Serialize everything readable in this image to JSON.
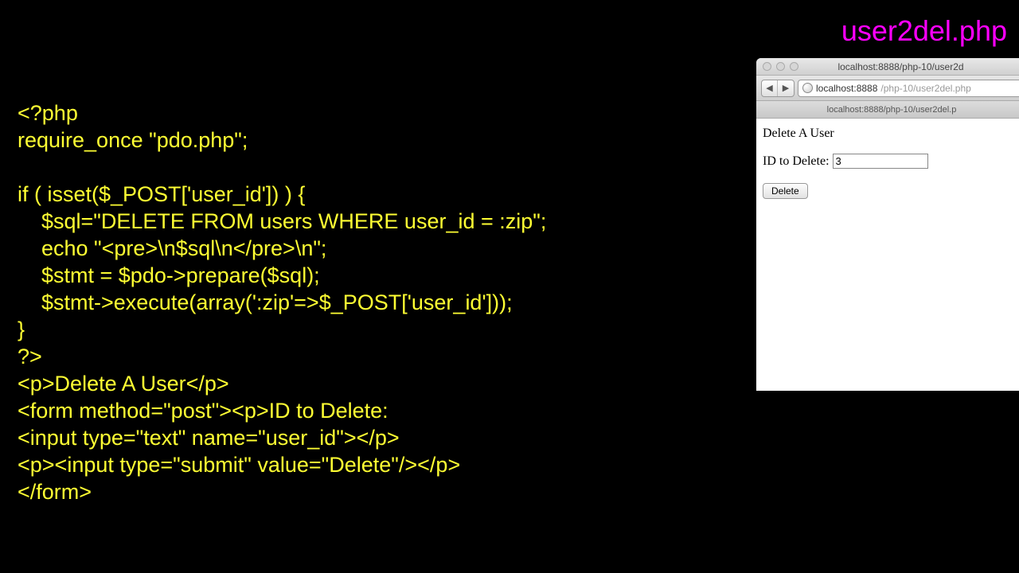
{
  "filename": "user2del.php",
  "code_lines": [
    "<?php",
    "require_once \"pdo.php\";",
    "",
    "if ( isset($_POST['user_id']) ) {",
    "    $sql=\"DELETE FROM users WHERE user_id = :zip\";",
    "    echo \"<pre>\\n$sql\\n</pre>\\n\";",
    "    $stmt = $pdo->prepare($sql);",
    "    $stmt->execute(array(':zip'=>$_POST['user_id']));",
    "}",
    "?>",
    "<p>Delete A User</p>",
    "<form method=\"post\"><p>ID to Delete:",
    "<input type=\"text\" name=\"user_id\"></p>",
    "<p><input type=\"submit\" value=\"Delete\"/></p>",
    "</form>"
  ],
  "browser": {
    "title": "localhost:8888/php-10/user2d",
    "address_host": "localhost:8888",
    "address_path": "/php-10/user2del.php",
    "tab": "localhost:8888/php-10/user2del.p",
    "nav_back": "◀",
    "nav_fwd": "▶"
  },
  "page": {
    "heading": "Delete A User",
    "label": "ID to Delete:",
    "input_value": "3",
    "button": "Delete"
  }
}
